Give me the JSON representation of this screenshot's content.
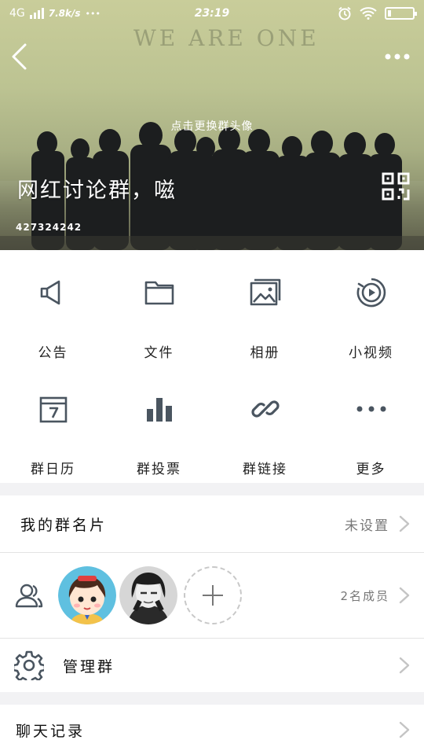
{
  "status_bar": {
    "network": "4G",
    "speed": "7.8k/s",
    "dots": "•••",
    "time": "23:19"
  },
  "header": {
    "banner_text": "WE ARE ONE",
    "change_avatar_text": "点击更换群头像",
    "group_name": "网红讨论群，嗞",
    "group_id": "427324242"
  },
  "features": [
    {
      "label": "公告",
      "icon": "megaphone-icon"
    },
    {
      "label": "文件",
      "icon": "folder-icon"
    },
    {
      "label": "相册",
      "icon": "photo-album-icon"
    },
    {
      "label": "小视频",
      "icon": "video-play-icon"
    },
    {
      "label": "群日历",
      "icon": "calendar-icon"
    },
    {
      "label": "群投票",
      "icon": "bar-chart-icon"
    },
    {
      "label": "群链接",
      "icon": "link-icon"
    },
    {
      "label": "更多",
      "icon": "more-dots-icon"
    }
  ],
  "my_card": {
    "title": "我的群名片",
    "value": "未设置"
  },
  "members": {
    "count_text": "2名成员"
  },
  "manage": {
    "title": "管理群"
  },
  "chat_history": {
    "title": "聊天记录"
  },
  "colors": {
    "icon": "#4a5560",
    "chevron": "#c4c4c4",
    "background": "#f2f2f4"
  }
}
